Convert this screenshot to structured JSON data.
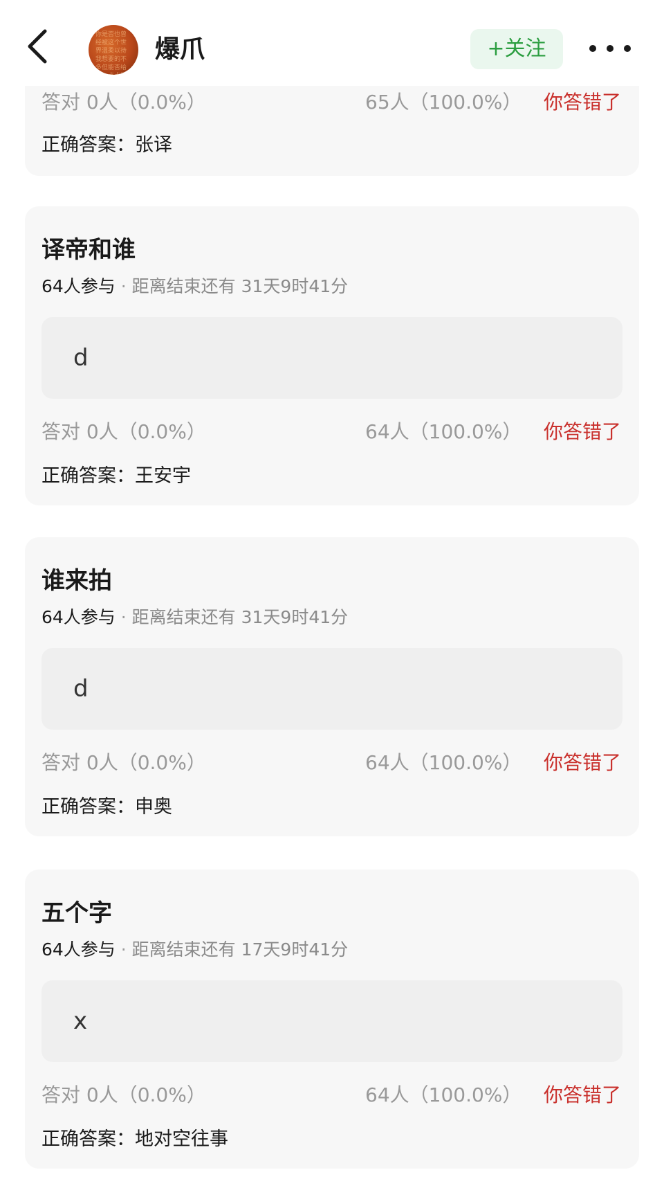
{
  "header": {
    "back_icon": "chevron-left-icon",
    "account_name": "爆爪",
    "follow_label": "+关注",
    "more_icon": "more-horizontal-icon",
    "avatar_text": "你是否也曾经被这个世界温柔以待我想要的不多但能否给我一点点温暖"
  },
  "colors": {
    "follow_bg": "#eaf7ee",
    "follow_text": "#2a9d3f",
    "wrong_red": "#c9302c",
    "card_bg": "#f7f7f7",
    "answer_bg": "#efefef"
  },
  "cards": [
    {
      "stats": {
        "correct": "答对 0人（0.0%）",
        "wrong": "65人（100.0%）",
        "result": "你答错了"
      },
      "correct_answer": "正确答案：张译"
    },
    {
      "title": "译帝和谁",
      "participants": "64人参与",
      "separator": "·",
      "remaining": "距离结束还有 31天9时41分",
      "my_answer": "d",
      "stats": {
        "correct": "答对 0人（0.0%）",
        "wrong": "64人（100.0%）",
        "result": "你答错了"
      },
      "correct_answer": "正确答案：王安宇"
    },
    {
      "title": "谁来拍",
      "participants": "64人参与",
      "separator": "·",
      "remaining": "距离结束还有 31天9时41分",
      "my_answer": "d",
      "stats": {
        "correct": "答对 0人（0.0%）",
        "wrong": "64人（100.0%）",
        "result": "你答错了"
      },
      "correct_answer": "正确答案：申奥"
    },
    {
      "title": "五个字",
      "participants": "64人参与",
      "separator": "·",
      "remaining": "距离结束还有 17天9时41分",
      "my_answer": "x",
      "stats": {
        "correct": "答对 0人（0.0%）",
        "wrong": "64人（100.0%）",
        "result": "你答错了"
      },
      "correct_answer": "正确答案：地对空往事"
    }
  ]
}
